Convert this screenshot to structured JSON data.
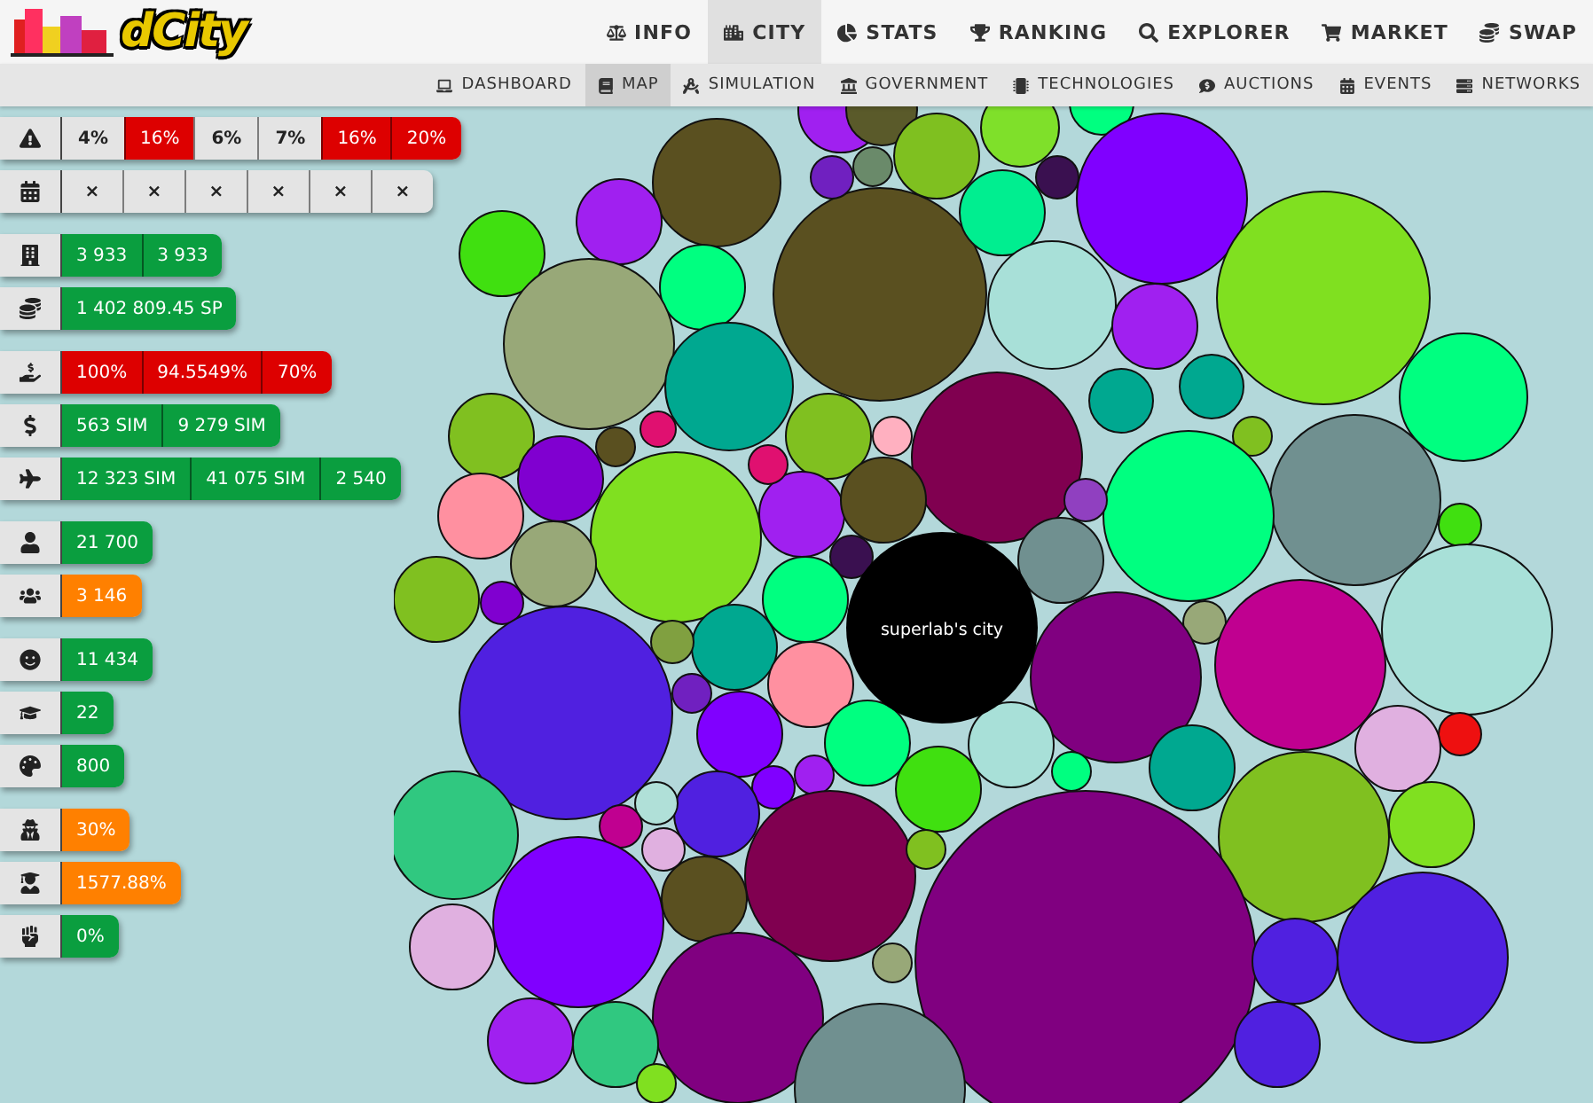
{
  "logo": {
    "text": "dCity"
  },
  "nav": [
    {
      "label": "INFO",
      "selected": false
    },
    {
      "label": "CITY",
      "selected": true
    },
    {
      "label": "STATS",
      "selected": false
    },
    {
      "label": "RANKING",
      "selected": false
    },
    {
      "label": "EXPLORER",
      "selected": false
    },
    {
      "label": "MARKET",
      "selected": false
    },
    {
      "label": "SWAP",
      "selected": false
    }
  ],
  "subnav": [
    {
      "label": "DASHBOARD",
      "selected": false
    },
    {
      "label": "MAP",
      "selected": true
    },
    {
      "label": "SIMULATION",
      "selected": false
    },
    {
      "label": "GOVERNMENT",
      "selected": false
    },
    {
      "label": "TECHNOLOGIES",
      "selected": false
    },
    {
      "label": "AUCTIONS",
      "selected": false
    },
    {
      "label": "EVENTS",
      "selected": false
    },
    {
      "label": "NETWORKS",
      "selected": false
    }
  ],
  "stat_groups": [
    [
      {
        "cells": [
          {
            "text": "4%",
            "color": "#e4e4e4"
          },
          {
            "text": "16%",
            "color": "#dd0000"
          },
          {
            "text": "6%",
            "color": "#e4e4e4"
          },
          {
            "text": "7%",
            "color": "#e4e4e4"
          },
          {
            "text": "16%",
            "color": "#dd0000"
          },
          {
            "text": "20%",
            "color": "#dd0000"
          }
        ]
      },
      {
        "cells": [
          {
            "text": "×",
            "color": "#e4e4e4"
          },
          {
            "text": "×",
            "color": "#e4e4e4"
          },
          {
            "text": "×",
            "color": "#e4e4e4"
          },
          {
            "text": "×",
            "color": "#e4e4e4"
          },
          {
            "text": "×",
            "color": "#e4e4e4"
          },
          {
            "text": "×",
            "color": "#e4e4e4"
          }
        ]
      }
    ],
    [
      {
        "cells": [
          {
            "text": "3 933",
            "color": "#0a9e3f"
          },
          {
            "text": "3 933",
            "color": "#0a9e3f"
          }
        ]
      },
      {
        "cells": [
          {
            "text": "1 402 809.45 SP",
            "color": "#0a9e3f"
          }
        ]
      }
    ],
    [
      {
        "cells": [
          {
            "text": "100%",
            "color": "#dd0000"
          },
          {
            "text": "94.5549%",
            "color": "#dd0000"
          },
          {
            "text": "70%",
            "color": "#dd0000"
          }
        ]
      },
      {
        "cells": [
          {
            "text": "563 SIM",
            "color": "#0a9e3f"
          },
          {
            "text": "9 279 SIM",
            "color": "#0a9e3f"
          }
        ]
      },
      {
        "cells": [
          {
            "text": "12 323 SIM",
            "color": "#0a9e3f"
          },
          {
            "text": "41 075 SIM",
            "color": "#0a9e3f"
          },
          {
            "text": "2 540",
            "color": "#0a9e3f"
          }
        ]
      }
    ],
    [
      {
        "cells": [
          {
            "text": "21 700",
            "color": "#0a9e3f"
          }
        ]
      },
      {
        "cells": [
          {
            "text": "3 146",
            "color": "#ff8000"
          }
        ]
      }
    ],
    [
      {
        "cells": [
          {
            "text": "11 434",
            "color": "#0a9e3f"
          }
        ]
      },
      {
        "cells": [
          {
            "text": "22",
            "color": "#0a9e3f"
          }
        ]
      },
      {
        "cells": [
          {
            "text": "800",
            "color": "#0a9e3f"
          }
        ]
      }
    ],
    [
      {
        "cells": [
          {
            "text": "30%",
            "color": "#ff8000"
          }
        ]
      },
      {
        "cells": [
          {
            "text": "1577.88%",
            "color": "#ff8000"
          }
        ]
      },
      {
        "cells": [
          {
            "text": "0%",
            "color": "#0a9e3f"
          }
        ]
      }
    ]
  ],
  "map": {
    "center_label": "superlab's city"
  }
}
